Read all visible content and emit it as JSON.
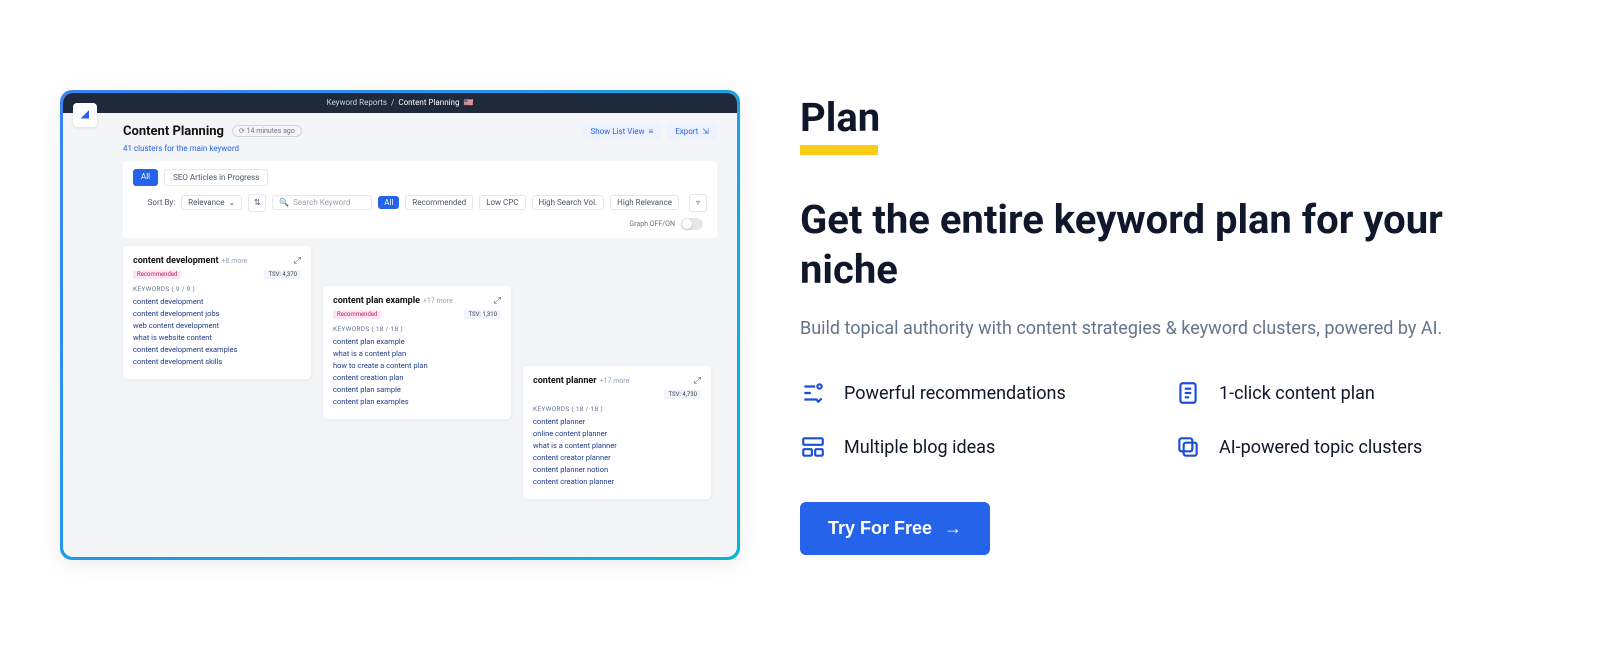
{
  "shot": {
    "breadcrumb_parent": "Keyword Reports",
    "breadcrumb_sep": "/",
    "breadcrumb_current": "Content Planning",
    "page_title": "Content Planning",
    "timestamp": "14 minutes ago",
    "subtitle": "41 clusters for the main keyword",
    "btn_listview": "Show List View",
    "btn_export": "Export",
    "tab_all": "All",
    "tab_progress": "SEO Articles in Progress",
    "sort_label": "Sort By:",
    "sort_value": "Relevance",
    "search_ph": "Search Keyword",
    "filters": [
      "All",
      "Recommended",
      "Low CPC",
      "High Search Vol.",
      "High Relevance"
    ],
    "toggle_label": "Graph OFF/ON",
    "clusters": [
      {
        "title": "content development",
        "more": "+8 more",
        "badge": "Recommended",
        "tsv": "TSV: 4,370",
        "kw_header": "KEYWORDS  ( 9 / 9 )",
        "kws": [
          "content development",
          "content development jobs",
          "web content development",
          "what is website content",
          "content development examples",
          "content development skills"
        ]
      },
      {
        "title": "content plan example",
        "more": "+17 more",
        "badge": "Recommended",
        "tsv": "TSV: 1,310",
        "kw_header": "KEYWORDS  ( 18 / 18 )",
        "kws": [
          "content plan example",
          "what is a content plan",
          "how to create a content plan",
          "content creation plan",
          "content plan sample",
          "content plan examples"
        ]
      },
      {
        "title": "content planner",
        "more": "+17 more",
        "badge": "",
        "tsv": "TSV: 4,730",
        "kw_header": "KEYWORDS  ( 18 / 18 )",
        "kws": [
          "content planner",
          "online content planner",
          "what is a content planner",
          "content creator planner",
          "content planner notion",
          "content creation planner"
        ]
      }
    ]
  },
  "right": {
    "eyebrow": "Plan",
    "heading": "Get the entire keyword plan for your niche",
    "lead": "Build topical authority with content strategies & keyword clusters, powered by AI.",
    "features": [
      "Powerful recommendations",
      "1-click content plan",
      "Multiple blog ideas",
      "AI-powered topic clusters"
    ],
    "cta": "Try For Free"
  }
}
